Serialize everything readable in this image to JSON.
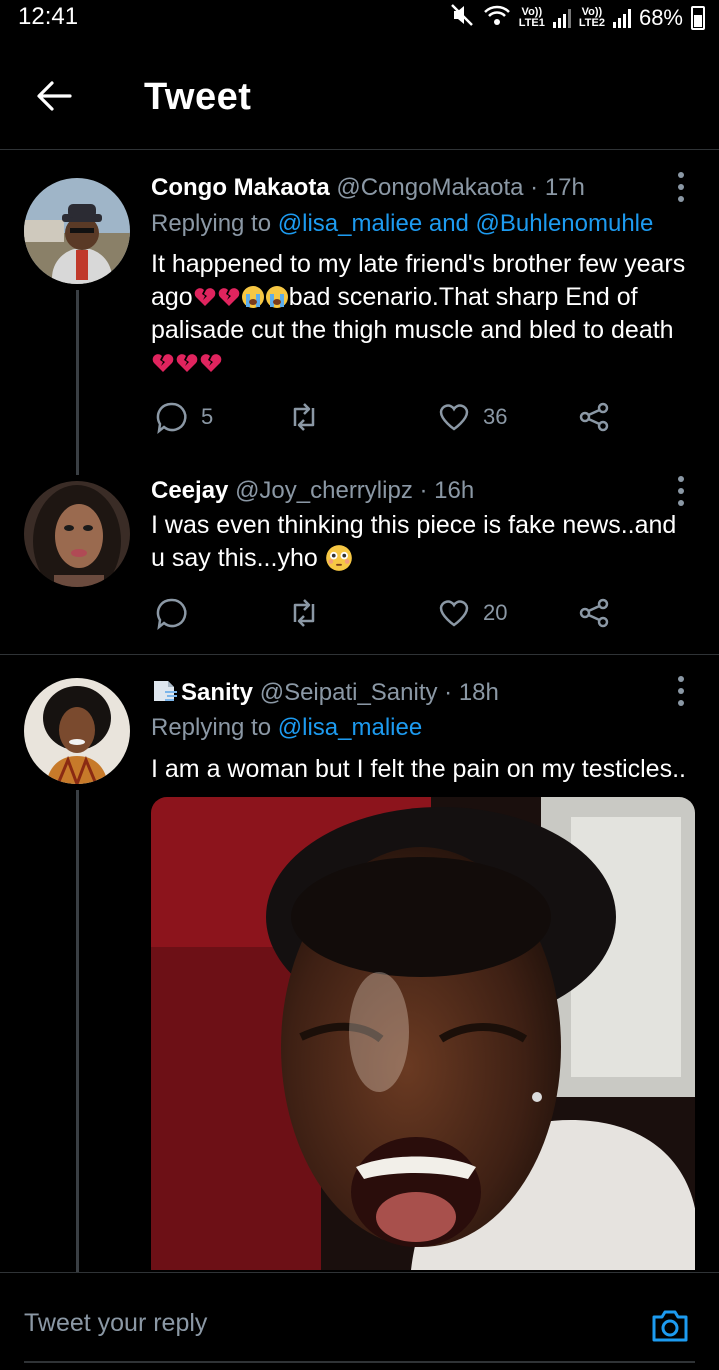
{
  "status_bar": {
    "time": "12:41",
    "lte1_top": "Vo))",
    "lte1_bottom": "LTE1",
    "lte2_top": "Vo))",
    "lte2_bottom": "LTE2",
    "battery": "68%",
    "icons": [
      "mute-icon",
      "wifi-icon",
      "signal-icon",
      "battery-icon"
    ]
  },
  "header": {
    "title": "Tweet",
    "back_icon": "arrow-left-icon"
  },
  "tweets": [
    {
      "name": "Congo Makaota",
      "handle": "@CongoMakaota",
      "time": "· 17h",
      "replying_prefix": "Replying to",
      "replying_links": "@lisa_maliee and @Buhlenomuhle",
      "text_1": "It happened to my late friend's brother few years ago",
      "text_2": "bad scenario.That sharp End of palisade cut the thigh muscle and bled to death",
      "reply_count": "5",
      "retweet_count": "",
      "like_count": "36"
    },
    {
      "name": "Ceejay",
      "handle": "@Joy_cherrylipz",
      "time": "· 16h",
      "text_1": "I was even thinking this piece is fake news..and u say this...yho",
      "reply_count": "",
      "retweet_count": "",
      "like_count": "20"
    },
    {
      "name": "Sanity",
      "handle": "@Seipati_Sanity",
      "time": "· 18h",
      "replying_prefix": "Replying to",
      "replying_links": "@lisa_maliee",
      "text_1": "I am a woman but I felt the pain on my testicles..",
      "media": "photo"
    }
  ],
  "reply_bar": {
    "placeholder": "Tweet your reply",
    "camera_icon": "camera-icon"
  },
  "colors": {
    "background": "#000000",
    "link": "#1d9bf0",
    "muted": "#8b98a5",
    "broken_heart": "#e0245e",
    "crying_face": "#f6c744"
  }
}
